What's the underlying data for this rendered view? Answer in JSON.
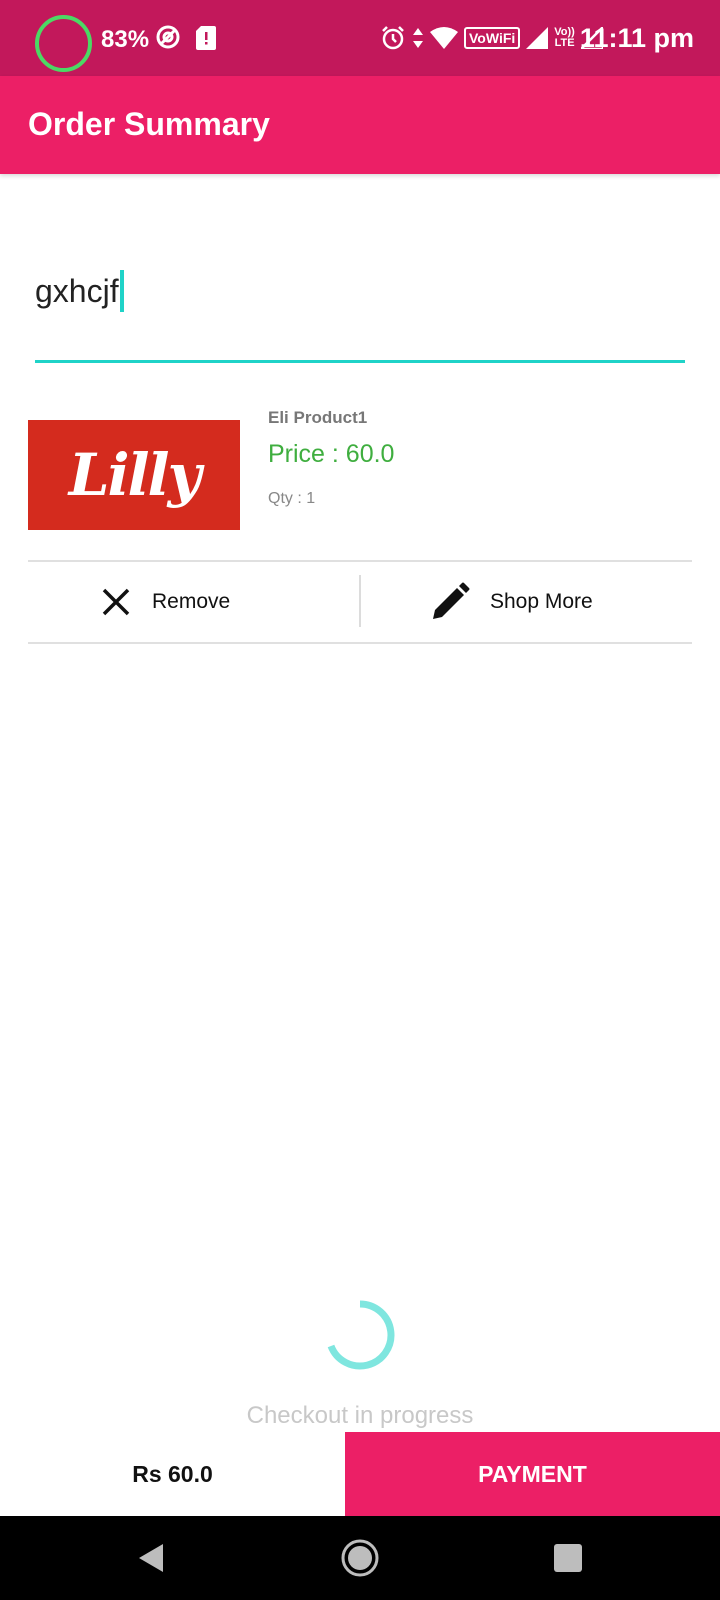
{
  "status_bar": {
    "battery_percent": "83%",
    "time": "11:11 pm",
    "vowifi_label": "VoWiFi",
    "volte_top": "Vo))",
    "volte_bottom": "LTE",
    "icons": [
      "battery-ring-icon",
      "at-icon",
      "sd-card-alert-icon",
      "alarm-icon",
      "data-arrows-icon",
      "wifi-icon",
      "vowifi-icon",
      "signal-icon",
      "volte-icon",
      "signal-icon"
    ]
  },
  "app_bar": {
    "title": "Order Summary",
    "color": "#ec1f66"
  },
  "name_input": {
    "value": "gxhcjf",
    "accent_color": "#1fd3c8"
  },
  "product": {
    "image_text": "Lilly",
    "name": "Eli Product1",
    "price": "Price : 60.0",
    "qty": "Qty : 1",
    "price_color": "#3fae3f"
  },
  "actions": {
    "remove_label": "Remove",
    "remove_icon": "close-icon",
    "shop_more_label": "Shop More",
    "shop_more_icon": "pencil-icon"
  },
  "progress": {
    "text": "Checkout in progress"
  },
  "bottom_bar": {
    "total": "Rs 60.0",
    "payment_label": "PAYMENT"
  },
  "nav_bar": {
    "icons": [
      "back-icon",
      "home-icon",
      "recents-icon"
    ]
  }
}
